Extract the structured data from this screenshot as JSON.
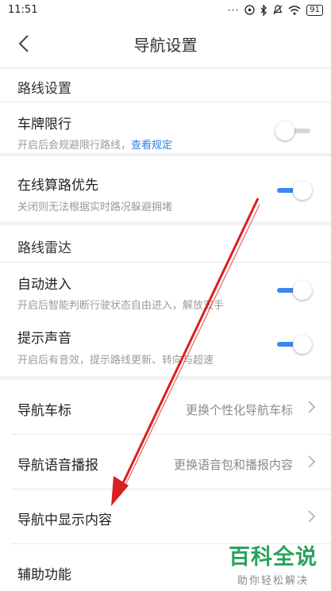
{
  "status_bar": {
    "time": "11:51",
    "battery": "91",
    "signal_dots": "···"
  },
  "header": {
    "title": "导航设置"
  },
  "route_settings": {
    "label": "路线设置",
    "plate_limit": {
      "title": "车牌限行",
      "subtitle": "开启后会规避限行路线，",
      "link": "查看规定",
      "enabled": false
    },
    "online_priority": {
      "title": "在线算路优先",
      "subtitle": "关闭则无法根据实时路况躲避拥堵",
      "enabled": true
    }
  },
  "route_radar": {
    "label": "路线雷达",
    "auto_enter": {
      "title": "自动进入",
      "subtitle": "开启后智能判断行驶状态自由进入，解放双手",
      "enabled": true
    },
    "sound": {
      "title": "提示声音",
      "subtitle": "开启后有音效，提示路线更新、转向与超速",
      "enabled": true
    }
  },
  "nav_items": [
    {
      "title": "导航车标",
      "value": "更换个性化导航车标"
    },
    {
      "title": "导航语音播报",
      "value": "更换语音包和播报内容"
    },
    {
      "title": "导航中显示内容",
      "value": ""
    },
    {
      "title": "辅助功能",
      "value": ""
    }
  ],
  "watermark": {
    "main": "百科全说",
    "sub": "助你轻松解决"
  },
  "colors": {
    "accent": "#3a87f0",
    "link": "#2d7ee8",
    "annotation": "#d92020",
    "watermark": "#2aa35c"
  },
  "annotation": {
    "type": "red-arrow",
    "direction": "down-left"
  }
}
